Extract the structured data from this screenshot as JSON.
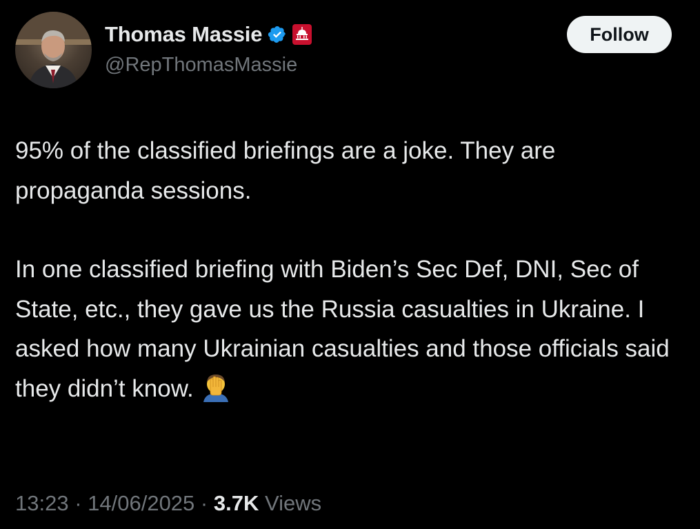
{
  "author": {
    "display_name": "Thomas Massie",
    "handle": "@RepThomasMassie",
    "verified_icon": "verified-badge-icon",
    "affiliation_icon": "capitol-affiliation-badge-icon"
  },
  "follow_button": {
    "label": "Follow"
  },
  "tweet": {
    "paragraph1": "95% of the classified briefings are a joke. They are propaganda sessions.",
    "paragraph2": "In one classified briefing with Biden’s Sec Def, DNI, Sec of State, etc., they gave us the Russia casualties in Ukraine. I asked how many Ukrainian casualties and those officials said they didn’t know.",
    "emoji": "facepalm-emoji"
  },
  "meta": {
    "time": "13:23",
    "separator": " · ",
    "date": "14/06/2025",
    "views_count": "3.7K",
    "views_label": "Views"
  },
  "colors": {
    "background": "#000000",
    "text_primary": "#e7e9ea",
    "text_secondary": "#71767b",
    "verified_blue": "#1d9bf0",
    "affiliation_red": "#c8102e",
    "follow_bg": "#eff3f4"
  }
}
